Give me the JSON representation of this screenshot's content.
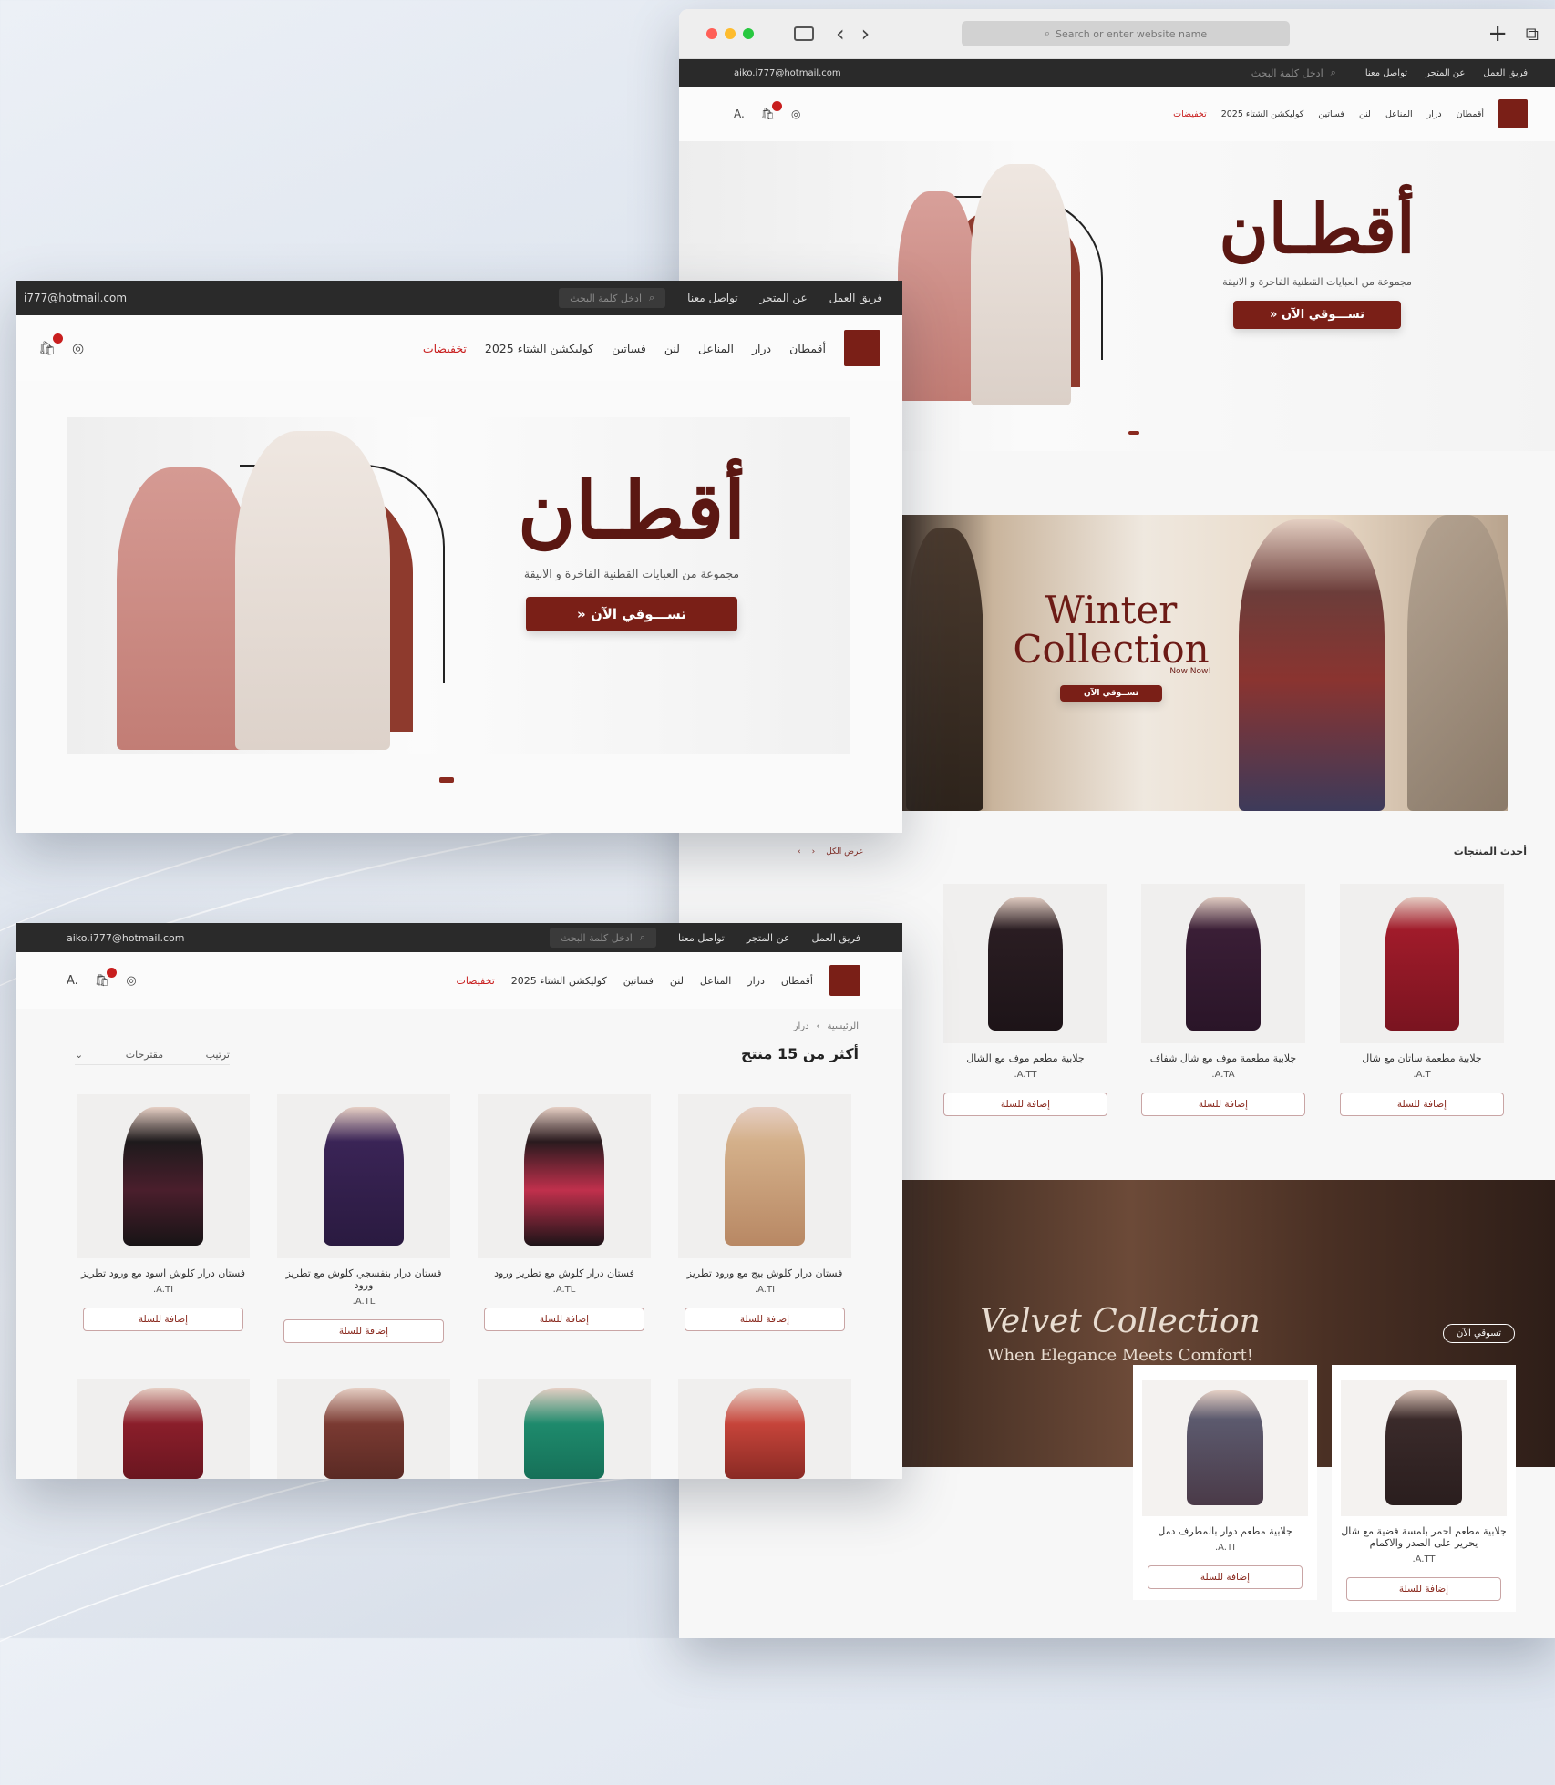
{
  "browser": {
    "url_placeholder": "Search or enter website name",
    "back": "‹",
    "forward": "›",
    "new_tab": "+",
    "tabs_icon": "⧉"
  },
  "topbar": {
    "email": "aiko.i777@hotmail.com",
    "email_short": "i777@hotmail.com",
    "links": [
      "فريق العمل",
      "عن المتجر",
      "تواصل معنا"
    ],
    "search_placeholder": "ادخل كلمة البحث"
  },
  "nav": {
    "items": [
      "أقمطان",
      "درار",
      "المناعل",
      "لنن",
      "فساتين",
      "كوليكشن الشتاء 2025"
    ],
    "hot_item": "تخفيضات",
    "hot_item_alt": "تخفيضات",
    "currency": "A.",
    "icons": [
      "cart-icon",
      "user-icon"
    ]
  },
  "hero": {
    "brand": "أقطـان",
    "tagline": "مجموعة من العبايات القطنية الفاخرة و الانيقة",
    "cta": "تســـوقي الآن  «"
  },
  "winter": {
    "title1": "Winter",
    "title2": "Collection",
    "sub": "Now Now!",
    "cta": "تســوقي الآن"
  },
  "latest": {
    "title": "أحدث المنتجات",
    "show_all": "عرض الكل",
    "products": [
      {
        "name": "جلابية مطعمة ساتان مع شال",
        "price": "A.T."
      },
      {
        "name": "جلابية مطعمة موف مع شال شفاف",
        "price": "A.TA."
      },
      {
        "name": "جلابية مطعم موف مع الشال",
        "price": "A.TT."
      }
    ]
  },
  "velvet": {
    "title": "Velvet Collection",
    "sub": "When Elegance Meets Comfort!",
    "btn": "تسوقي الآن",
    "products": [
      {
        "name": "جلابية مطعم دوار بالمطرف دمل",
        "price": "A.TI."
      },
      {
        "name": "جلابية مطعم احمر بلمسة فضية مع شال يحرير على الصدر والاكمام",
        "price": "A.TT."
      }
    ]
  },
  "catalog": {
    "breadcrumb_home": "الرئيسية",
    "breadcrumb_sep": "›",
    "breadcrumb_cat": "درار",
    "count": "أكثر من 15 منتج",
    "sort_label": "ترتيب",
    "sort_value": "مقترحات",
    "products": [
      {
        "name": "فستان درار كلوش بيج مع ورود تطريز",
        "price": "A.TI."
      },
      {
        "name": "فستان درار كلوش مع تطريز ورود",
        "price": "A.TL."
      },
      {
        "name": "فستان درار بنفسجي كلوش مع تطريز ورود",
        "price": "A.TL."
      },
      {
        "name": "فستان درار كلوش اسود مع ورود تطريز",
        "price": "A.TI."
      }
    ]
  },
  "labels": {
    "add_to_cart": "إضافة للسلة"
  },
  "colors": {
    "brand": "#7a1f17",
    "dark_bar": "#2a2a2a",
    "sale": "#c81e1e"
  }
}
